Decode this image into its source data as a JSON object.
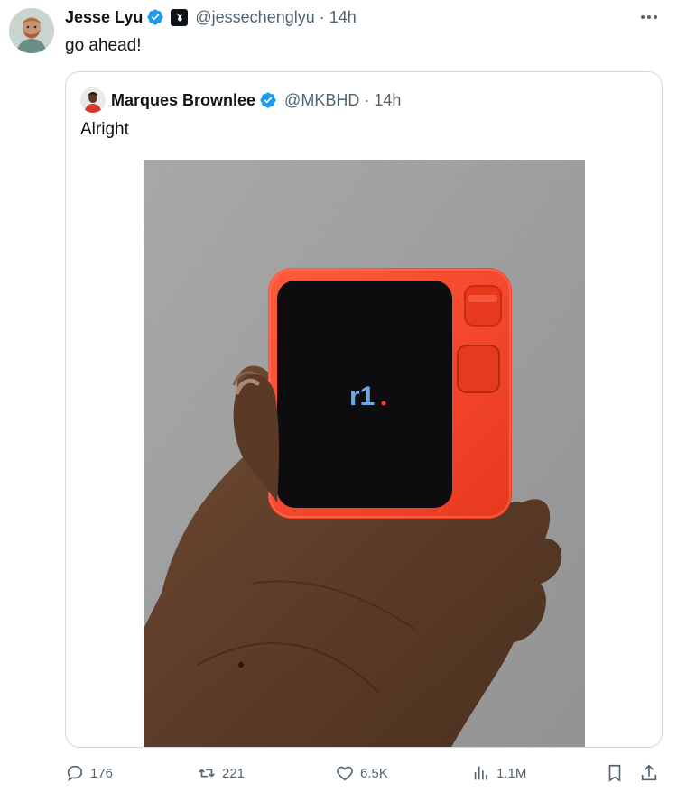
{
  "tweet": {
    "author_name": "Jesse Lyu",
    "handle": "@jessechenglyu",
    "dot": "·",
    "time": "14h",
    "text": "go ahead!",
    "more_icon": "more-horizontal-icon"
  },
  "quote": {
    "author_name": "Marques Brownlee",
    "handle": "@MKBHD",
    "dot": "·",
    "time": "14h",
    "text": "Alright",
    "media_screen_logo": "r1"
  },
  "actions": {
    "replies": "176",
    "reposts": "221",
    "likes": "6.5K",
    "views": "1.1M"
  },
  "colors": {
    "verified": "#1d9bf0",
    "secondary_text": "#536471",
    "device_orange": "#f0432a",
    "border": "#cfd9de"
  }
}
